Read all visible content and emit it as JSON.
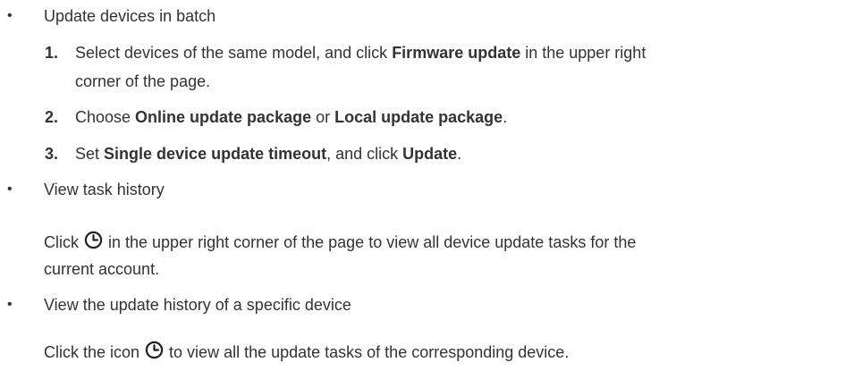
{
  "section1": {
    "bullet": "•",
    "heading": "Update devices in batch",
    "steps": [
      {
        "num": "1.",
        "line1_a": "Select devices of the same model, and click ",
        "line1_b": "Firmware update",
        "line1_c": " in the upper right",
        "line2": "corner of the page."
      },
      {
        "num": "2.",
        "a": "Choose ",
        "b": "Online update package",
        "c": " or ",
        "d": "Local update package",
        "e": "."
      },
      {
        "num": "3.",
        "a": "Set ",
        "b": "Single device update timeout",
        "c": ", and click ",
        "d": "Update",
        "e": "."
      }
    ]
  },
  "section2": {
    "bullet": "•",
    "heading": "View task history",
    "line1_a": "Click ",
    "line1_b": " in the upper right corner of the page to view all device update tasks for the",
    "line2": "current account."
  },
  "section3": {
    "bullet": "•",
    "heading": "View the update history of a specific device",
    "line1_a": "Click the icon ",
    "line1_b": " to view all the update tasks of the corresponding device."
  },
  "icons": {
    "history": "history-clock-icon"
  }
}
